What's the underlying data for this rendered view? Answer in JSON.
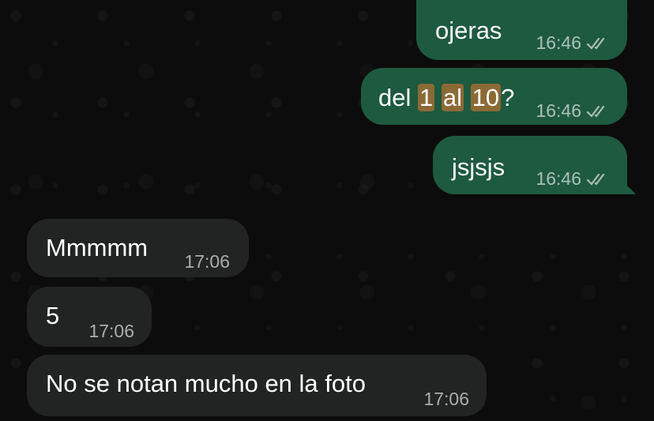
{
  "messages": [
    {
      "text": "ojeras",
      "time": "16:46",
      "status_icon": "double-check-icon"
    },
    {
      "segments": [
        {
          "text": "del ",
          "highlight": false
        },
        {
          "text": "1",
          "highlight": true
        },
        {
          "text": " ",
          "highlight": false
        },
        {
          "text": "al",
          "highlight": true
        },
        {
          "text": " ",
          "highlight": false
        },
        {
          "text": "10",
          "highlight": true
        },
        {
          "text": "?",
          "highlight": false
        }
      ],
      "time": "16:46",
      "status_icon": "double-check-icon"
    },
    {
      "text": "jsjsjs",
      "time": "16:46",
      "status_icon": "double-check-icon"
    },
    {
      "text": "Mmmmm",
      "time": "17:06"
    },
    {
      "text": "5",
      "time": "17:06"
    },
    {
      "text": "No se notan mucho en la foto",
      "time": "17:06"
    }
  ],
  "colors": {
    "outgoing_bubble": "#1e5a40",
    "incoming_bubble": "#222424",
    "highlight": "#8b6a36",
    "background": "#0c0c0c"
  }
}
